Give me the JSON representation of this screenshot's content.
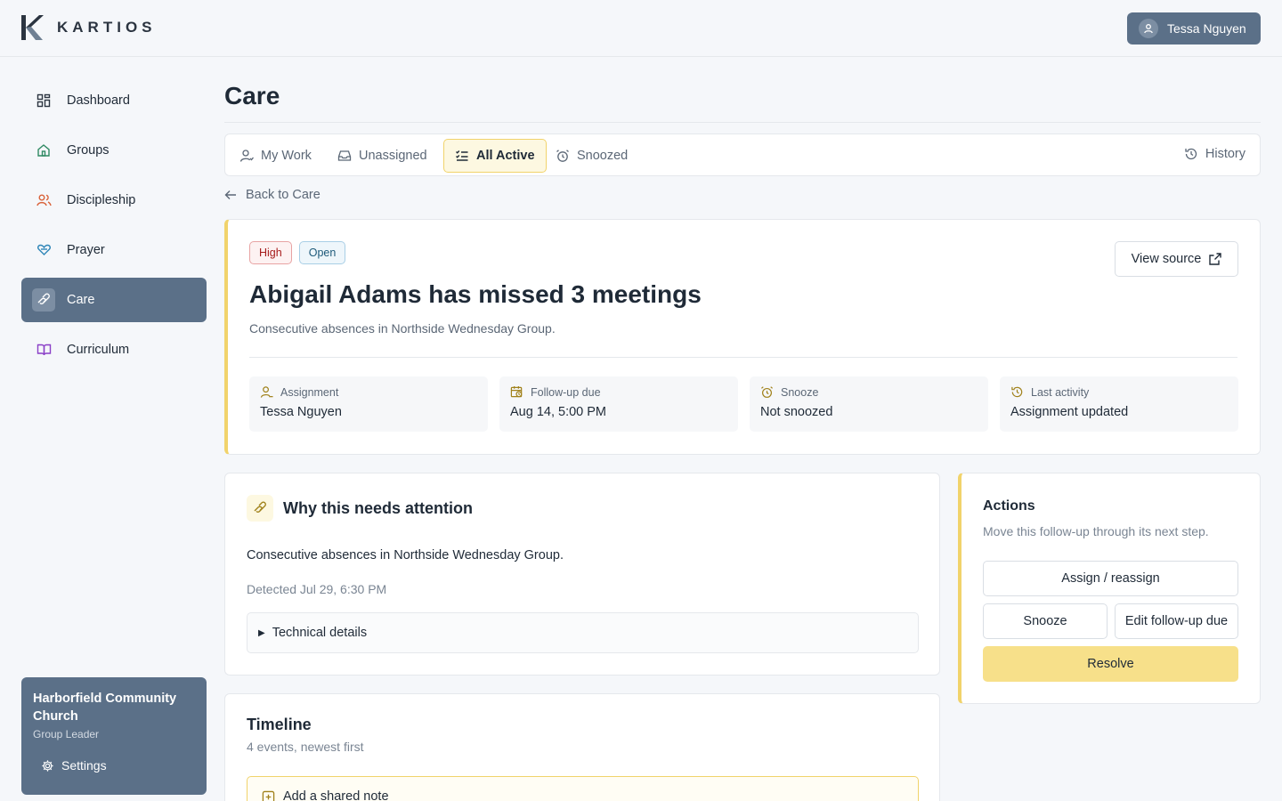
{
  "brand": {
    "name": "KARTIOS"
  },
  "user": {
    "name": "Tessa Nguyen"
  },
  "nav": [
    {
      "label": "Dashboard",
      "icon": "dashboard-icon"
    },
    {
      "label": "Groups",
      "icon": "home-icon"
    },
    {
      "label": "Discipleship",
      "icon": "users-icon"
    },
    {
      "label": "Prayer",
      "icon": "heart-hands-icon"
    },
    {
      "label": "Care",
      "icon": "care-hands-icon",
      "active": true
    },
    {
      "label": "Curriculum",
      "icon": "book-icon"
    }
  ],
  "org": {
    "name": "Harborfield Community Church",
    "role": "Group Leader",
    "settings_label": "Settings"
  },
  "page": {
    "title": "Care"
  },
  "tabs": [
    {
      "label": "My Work"
    },
    {
      "label": "Unassigned"
    },
    {
      "label": "All Active",
      "active": true
    },
    {
      "label": "Snoozed"
    }
  ],
  "history_label": "History",
  "back_label": "Back to Care",
  "item": {
    "priority": "High",
    "status": "Open",
    "title": "Abigail Adams has missed 3 meetings",
    "subtitle": "Consecutive absences in Northside Wednesday Group.",
    "view_source_label": "View source",
    "meta": [
      {
        "label": "Assignment",
        "value": "Tessa Nguyen"
      },
      {
        "label": "Follow-up due",
        "value": "Aug 14, 5:00 PM"
      },
      {
        "label": "Snooze",
        "value": "Not snoozed"
      },
      {
        "label": "Last activity",
        "value": "Assignment updated"
      }
    ]
  },
  "why": {
    "title": "Why this needs attention",
    "text": "Consecutive absences in Northside Wednesday Group.",
    "detected": "Detected Jul 29, 6:30 PM",
    "details_label": "Technical details"
  },
  "actions": {
    "title": "Actions",
    "subtitle": "Move this follow-up through its next step.",
    "assign_label": "Assign / reassign",
    "snooze_label": "Snooze",
    "edit_due_label": "Edit follow-up due",
    "resolve_label": "Resolve"
  },
  "timeline": {
    "title": "Timeline",
    "subtitle": "4 events, newest first",
    "note_label": "Add a shared note"
  },
  "colors": {
    "accent": "#f1d36b",
    "sidebar_active": "#5b7088",
    "resolve": "#f7e08a"
  }
}
